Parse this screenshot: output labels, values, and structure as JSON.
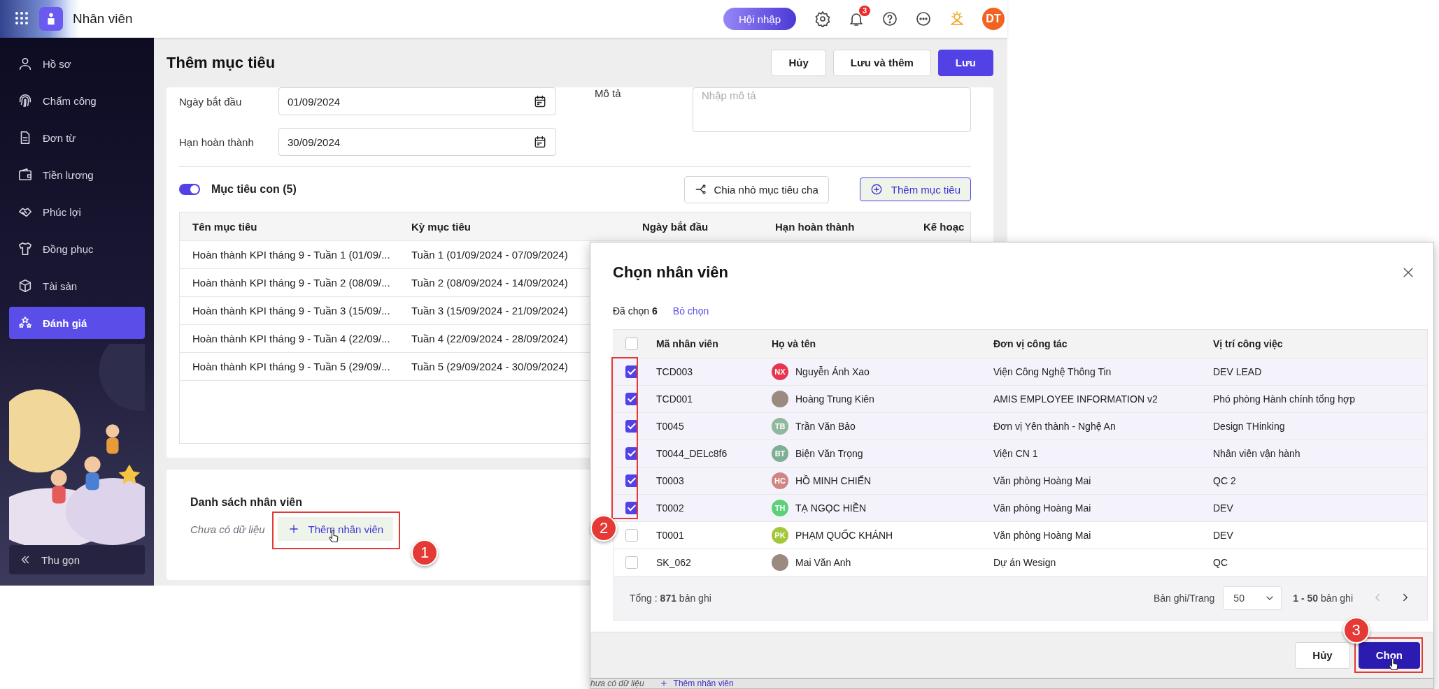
{
  "header": {
    "app_title": "Nhân viên",
    "onboarding_button": "Hội nhập",
    "notification_count": "3",
    "avatar_initials": "DT"
  },
  "sidebar": {
    "items": [
      {
        "label": "Hồ sơ",
        "selected": false
      },
      {
        "label": "Chấm công",
        "selected": false
      },
      {
        "label": "Đơn từ",
        "selected": false
      },
      {
        "label": "Tiền lương",
        "selected": false
      },
      {
        "label": "Phúc lợi",
        "selected": false
      },
      {
        "label": "Đồng phục",
        "selected": false
      },
      {
        "label": "Tài sản",
        "selected": false
      },
      {
        "label": "Đánh giá",
        "selected": true
      }
    ],
    "collapse_button": "Thu gọn"
  },
  "page": {
    "title": "Thêm mục tiêu",
    "buttons": [
      {
        "label": "Hủy",
        "kind": "secondary"
      },
      {
        "label": "Lưu và thêm",
        "kind": "secondary"
      },
      {
        "label": "Lưu",
        "kind": "primary"
      }
    ]
  },
  "form": {
    "fields": [
      {
        "label": "Ngày bắt đầu",
        "value": "01/09/2024"
      },
      {
        "label": "Hạn hoàn thành",
        "value": "30/09/2024"
      }
    ],
    "description": {
      "label": "Mô tả",
      "placeholder": "Nhập mô tả"
    }
  },
  "sub_goals": {
    "enabled": true,
    "title": "Mục tiêu con (5)",
    "buttons": [
      {
        "label": "Chia nhỏ mục tiêu cha",
        "kind": "split"
      },
      {
        "label": "Thêm mục tiêu",
        "kind": "add"
      }
    ],
    "table": {
      "columns": [
        "Tên mục tiêu",
        "Kỳ mục tiêu",
        "Ngày bắt đầu",
        "Hạn hoàn thành",
        "Kế hoạc"
      ],
      "rows": [
        [
          "Hoàn thành KPI tháng 9 - Tuần 1 (01/09/...",
          "Tuần 1 (01/09/2024 - 07/09/2024)"
        ],
        [
          "Hoàn thành KPI tháng 9 - Tuần 2 (08/09/...",
          "Tuần 2 (08/09/2024 - 14/09/2024)"
        ],
        [
          "Hoàn thành KPI tháng 9 - Tuần 3 (15/09/...",
          "Tuần 3 (15/09/2024 - 21/09/2024)"
        ],
        [
          "Hoàn thành KPI tháng 9 - Tuần 4 (22/09/...",
          "Tuần 4 (22/09/2024 - 28/09/2024)"
        ],
        [
          "Hoàn thành KPI tháng 9 - Tuần 5 (29/09/...",
          "Tuần 5 (29/09/2024 - 30/09/2024)"
        ]
      ]
    }
  },
  "employees_section": {
    "title": "Danh sách nhân viên",
    "empty_text": "Chưa có dữ liệu",
    "add_button": "Thêm nhân viên"
  },
  "dialog": {
    "title": "Chọn nhân viên",
    "selected_text": "Đã chọn **6**",
    "clear_link": "Bỏ chọn",
    "all_selected": false,
    "columns": [
      "Mã nhân viên",
      "Họ và tên",
      "Đơn vị công tác",
      "Vị trí công việc"
    ],
    "rows": [
      {
        "selected": true,
        "code": "TCD003",
        "name": "Nguyễn Ánh Xao",
        "unit": "Viện Công Nghệ Thông Tin",
        "position": "DEV LEAD",
        "avatar": {
          "kind": "initials",
          "text": "NX",
          "color": "#e8344e"
        }
      },
      {
        "selected": true,
        "code": "TCD001",
        "name": "Hoàng Trung Kiên",
        "unit": "AMIS EMPLOYEE INFORMATION v2",
        "position": "Phó phòng Hành chính tổng hợp",
        "avatar": {
          "kind": "photo"
        }
      },
      {
        "selected": true,
        "code": "T0045",
        "name": "Trần Văn Bảo",
        "unit": "Đơn vị Yên thành - Nghệ An",
        "position": "Design THinking",
        "avatar": {
          "kind": "initials",
          "text": "TB",
          "color": "#8fb89c"
        }
      },
      {
        "selected": true,
        "code": "T0044_DELc8f6",
        "name": "Biện Văn Trọng",
        "unit": "Viện CN 1",
        "position": "Nhân viên vận hành",
        "avatar": {
          "kind": "initials",
          "text": "BT",
          "color": "#7daf92"
        }
      },
      {
        "selected": true,
        "code": "T0003",
        "name": "HỒ MINH CHIẾN",
        "unit": "Văn phòng Hoàng Mai",
        "position": "QC 2",
        "avatar": {
          "kind": "initials",
          "text": "HC",
          "color": "#d08484"
        }
      },
      {
        "selected": true,
        "code": "T0002",
        "name": "TẠ NGỌC HIỀN",
        "unit": "Văn phòng Hoàng Mai",
        "position": "DEV",
        "avatar": {
          "kind": "initials",
          "text": "TH",
          "color": "#5cd178"
        }
      },
      {
        "selected": false,
        "code": "T0001",
        "name": "PHẠM QUỐC KHÁNH",
        "unit": "Văn phòng Hoàng Mai",
        "position": "DEV",
        "avatar": {
          "kind": "initials",
          "text": "PK",
          "color": "#a3c83a"
        }
      },
      {
        "selected": false,
        "code": "SK_062",
        "name": "Mai Văn Anh",
        "unit": "Dự án Wesign",
        "position": "QC",
        "avatar": {
          "kind": "photo"
        }
      }
    ],
    "total_text": "Tổng : **871** bản ghi",
    "page_size_label": "Bản ghi/Trang",
    "page_size": "50",
    "range_text": "**1 - 50** bản ghi",
    "buttons": [
      {
        "label": "Hủy",
        "kind": "secondary"
      },
      {
        "label": "Chọn",
        "kind": "primary"
      }
    ]
  },
  "background_strip": {
    "empty_text": "hưa có dữ liệu",
    "add_button": "Thêm nhân viên"
  },
  "annotations": [
    {
      "number": "1"
    },
    {
      "number": "2"
    },
    {
      "number": "3"
    }
  ]
}
